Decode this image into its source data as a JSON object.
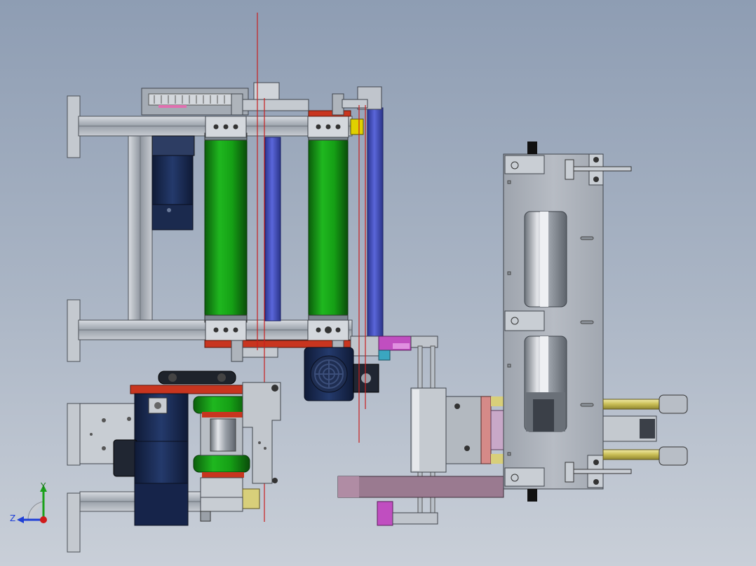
{
  "viewport": {
    "background_top": "#8e9db3",
    "background_bottom": "#c9cfd8"
  },
  "triad": {
    "z_label": "Z",
    "y_label": "Y",
    "z_color": "#1f3fd6",
    "y_color": "#1aa11a",
    "x_color": "#d01a1a"
  },
  "colors": {
    "green_roller": "#16a016",
    "blue_roller": "#4a55c8",
    "motor": "#1c2d55",
    "red_plate": "#c8351f",
    "frame": "#b8bec6",
    "pink_bar": "#9a7a90",
    "yellow_rod": "#d8cf7a",
    "magenta_part": "#c04ec0",
    "guide_line": "#c81e1e"
  }
}
